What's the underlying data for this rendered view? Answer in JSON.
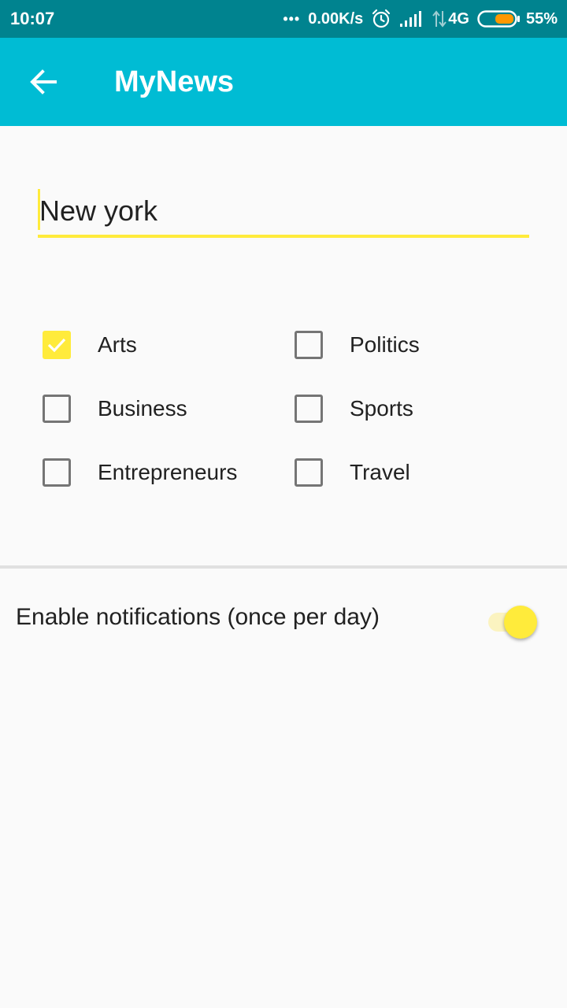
{
  "status_bar": {
    "time": "10:07",
    "dots": "•••",
    "net_speed": "0.00K/s",
    "network_type": "4G",
    "battery_percent": "55%",
    "battery_level": 0.55,
    "icons": [
      "alarm-icon",
      "signal-icon",
      "data-arrows-icon",
      "battery-icon"
    ]
  },
  "app_bar": {
    "title": "MyNews",
    "back_icon": "arrow-left-icon",
    "background": "#00bcd4"
  },
  "search": {
    "value": "New york",
    "accent": "#ffeb3b"
  },
  "categories": [
    {
      "label": "Arts",
      "checked": true
    },
    {
      "label": "Politics",
      "checked": false
    },
    {
      "label": "Business",
      "checked": false
    },
    {
      "label": "Sports",
      "checked": false
    },
    {
      "label": "Entrepreneurs",
      "checked": false
    },
    {
      "label": "Travel",
      "checked": false
    }
  ],
  "notifications": {
    "label": "Enable notifications (once per day)",
    "enabled": true
  }
}
